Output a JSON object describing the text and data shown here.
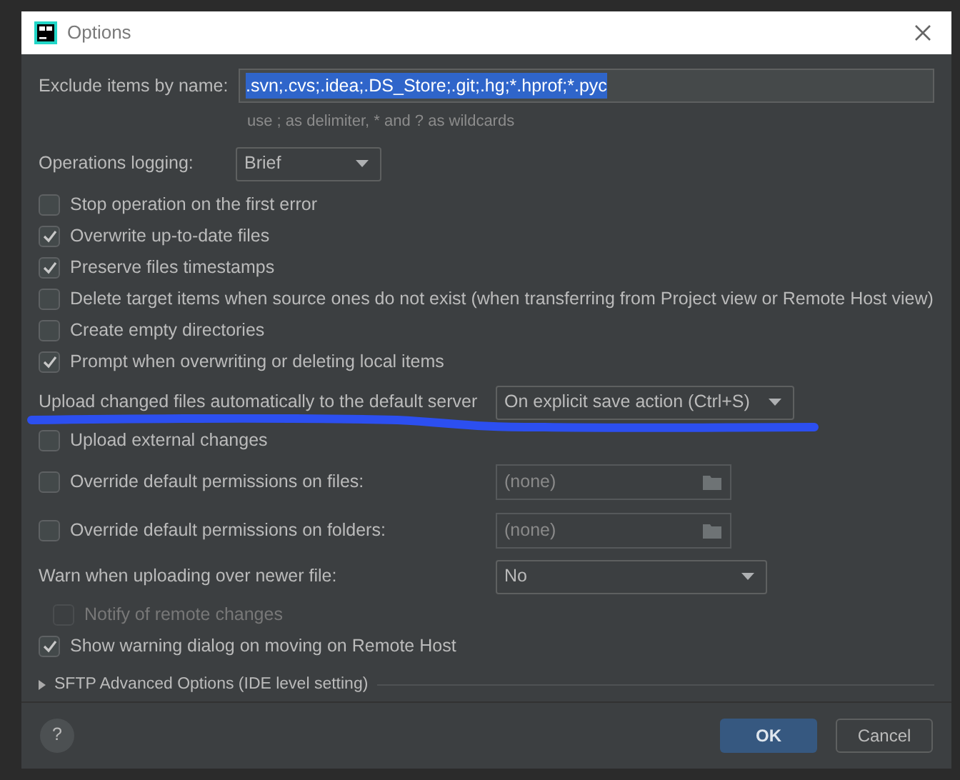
{
  "window": {
    "title": "Options"
  },
  "exclude": {
    "label": "Exclude items by name:",
    "value": ".svn;.cvs;.idea;.DS_Store;.git;.hg;*.hprof;*.pyc",
    "hint": "use ; as delimiter, * and ? as wildcards"
  },
  "operations_logging": {
    "label": "Operations logging:",
    "value": "Brief"
  },
  "checkboxes": [
    {
      "label": "Stop operation on the first error",
      "checked": false
    },
    {
      "label": "Overwrite up-to-date files",
      "checked": true
    },
    {
      "label": "Preserve files timestamps",
      "checked": true
    },
    {
      "label": "Delete target items when source ones do not exist (when transferring from Project view or Remote Host view)",
      "checked": false
    },
    {
      "label": "Create empty directories",
      "checked": false
    },
    {
      "label": "Prompt when overwriting or deleting local items",
      "checked": true
    }
  ],
  "upload_auto": {
    "label": "Upload changed files automatically to the default server",
    "value": "On explicit save action (Ctrl+S)"
  },
  "upload_external": {
    "label": "Upload external changes",
    "checked": false
  },
  "permissions": [
    {
      "label": "Override default permissions on files:",
      "checked": false,
      "value": "(none)",
      "disabled": true
    },
    {
      "label": "Override default permissions on folders:",
      "checked": false,
      "value": "(none)",
      "disabled": true
    }
  ],
  "warn_newer": {
    "label": "Warn when uploading over newer file:",
    "value": "No"
  },
  "notify": {
    "label": "Notify of remote changes",
    "checked": false,
    "disabled": true
  },
  "show_warning": {
    "label": "Show warning dialog on moving on Remote Host",
    "checked": true
  },
  "sftp": {
    "label": "SFTP Advanced Options (IDE level setting)",
    "expanded": false
  },
  "buttons": [
    {
      "kind": "help",
      "label": "?"
    },
    {
      "kind": "primary",
      "label": "OK"
    },
    {
      "kind": "secondary",
      "label": "Cancel"
    }
  ]
}
